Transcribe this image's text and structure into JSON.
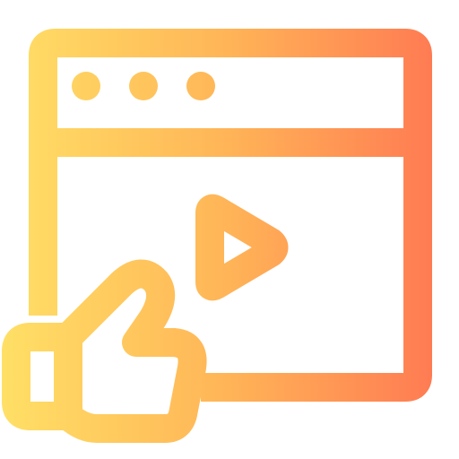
{
  "icon": {
    "name": "video-like-icon",
    "parts": [
      "browser-window-icon",
      "play-button-icon",
      "thumbs-up-icon"
    ]
  },
  "colors": {
    "gradient_start": "#FFE066",
    "gradient_mid": "#FFB457",
    "gradient_end": "#FF7452",
    "background": "#FFFFFF"
  }
}
